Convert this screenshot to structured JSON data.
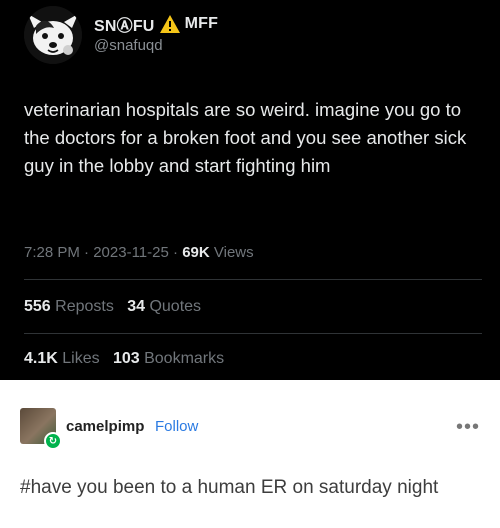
{
  "tweet": {
    "display_name": "SNⒶFU",
    "name_suffix": "MFF",
    "handle": "@snafuqd",
    "text": "veterinarian hospitals are so weird. imagine you go to the doctors for a broken foot and you see another sick guy in the lobby and start fighting him",
    "time": "7:28 PM",
    "date": "2023-11-25",
    "views_count": "69K",
    "views_label": "Views",
    "reposts_count": "556",
    "reposts_label": "Reposts",
    "quotes_count": "34",
    "quotes_label": "Quotes",
    "likes_count": "4.1K",
    "likes_label": "Likes",
    "bookmarks_count": "103",
    "bookmarks_label": "Bookmarks"
  },
  "tumblr_post": {
    "username": "camelpimp",
    "follow_label": "Follow",
    "more_label": "•••",
    "tag_text": "#have you been to a human ER on saturday night",
    "badge_icon": "reblog-icon",
    "accent_color": "#2a7ae2"
  }
}
